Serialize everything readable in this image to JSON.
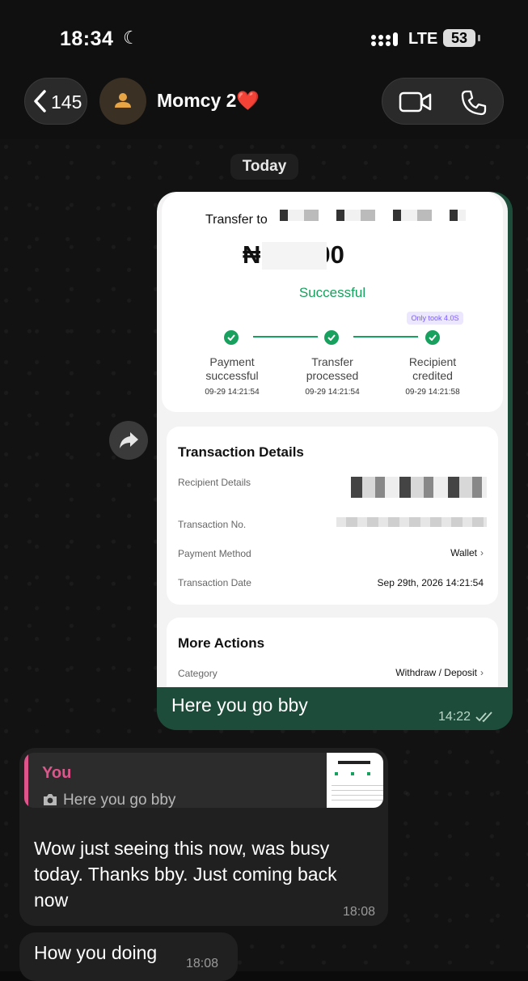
{
  "status_bar": {
    "time": "18:34",
    "network": "LTE",
    "battery": "53"
  },
  "header": {
    "back_count": "145",
    "contact_name": "Momcy 2❤️"
  },
  "chat": {
    "date_chip": "Today",
    "outgoing": {
      "caption": "Here you go bby",
      "time": "14:22",
      "receipt": {
        "transfer_to": "Transfer to",
        "amount": "₦  000.00",
        "status": "Successful",
        "badge": "Only took 4.0S",
        "steps": [
          {
            "label": "Payment successful",
            "time": "09-29 14:21:54"
          },
          {
            "label": "Transfer processed",
            "time": "09-29 14:21:54"
          },
          {
            "label": "Recipient credited",
            "time": "09-29 14:21:58"
          }
        ],
        "details_title": "Transaction Details",
        "rows": [
          {
            "label": "Recipient Details",
            "value": ""
          },
          {
            "label": "Transaction No.",
            "value": ""
          },
          {
            "label": "Payment Method",
            "value": "Wallet"
          },
          {
            "label": "Transaction Date",
            "value": "Sep 29th, 2026 14:21:54"
          }
        ],
        "more_title": "More Actions",
        "category_label": "Category",
        "category_value": "Withdraw / Deposit"
      }
    },
    "incoming": [
      {
        "quote_author": "You",
        "quote_text": "Here you go bby",
        "text": "Wow just seeing this now, was busy today. Thanks bby. Just coming back now",
        "time": "18:08"
      },
      {
        "text": "How you doing",
        "time": "18:08"
      }
    ]
  },
  "colors": {
    "outgoing_bubble": "#1d4d3a",
    "incoming_bubble": "#202020",
    "success_green": "#18a05e",
    "quote_accent": "#e0548c"
  }
}
